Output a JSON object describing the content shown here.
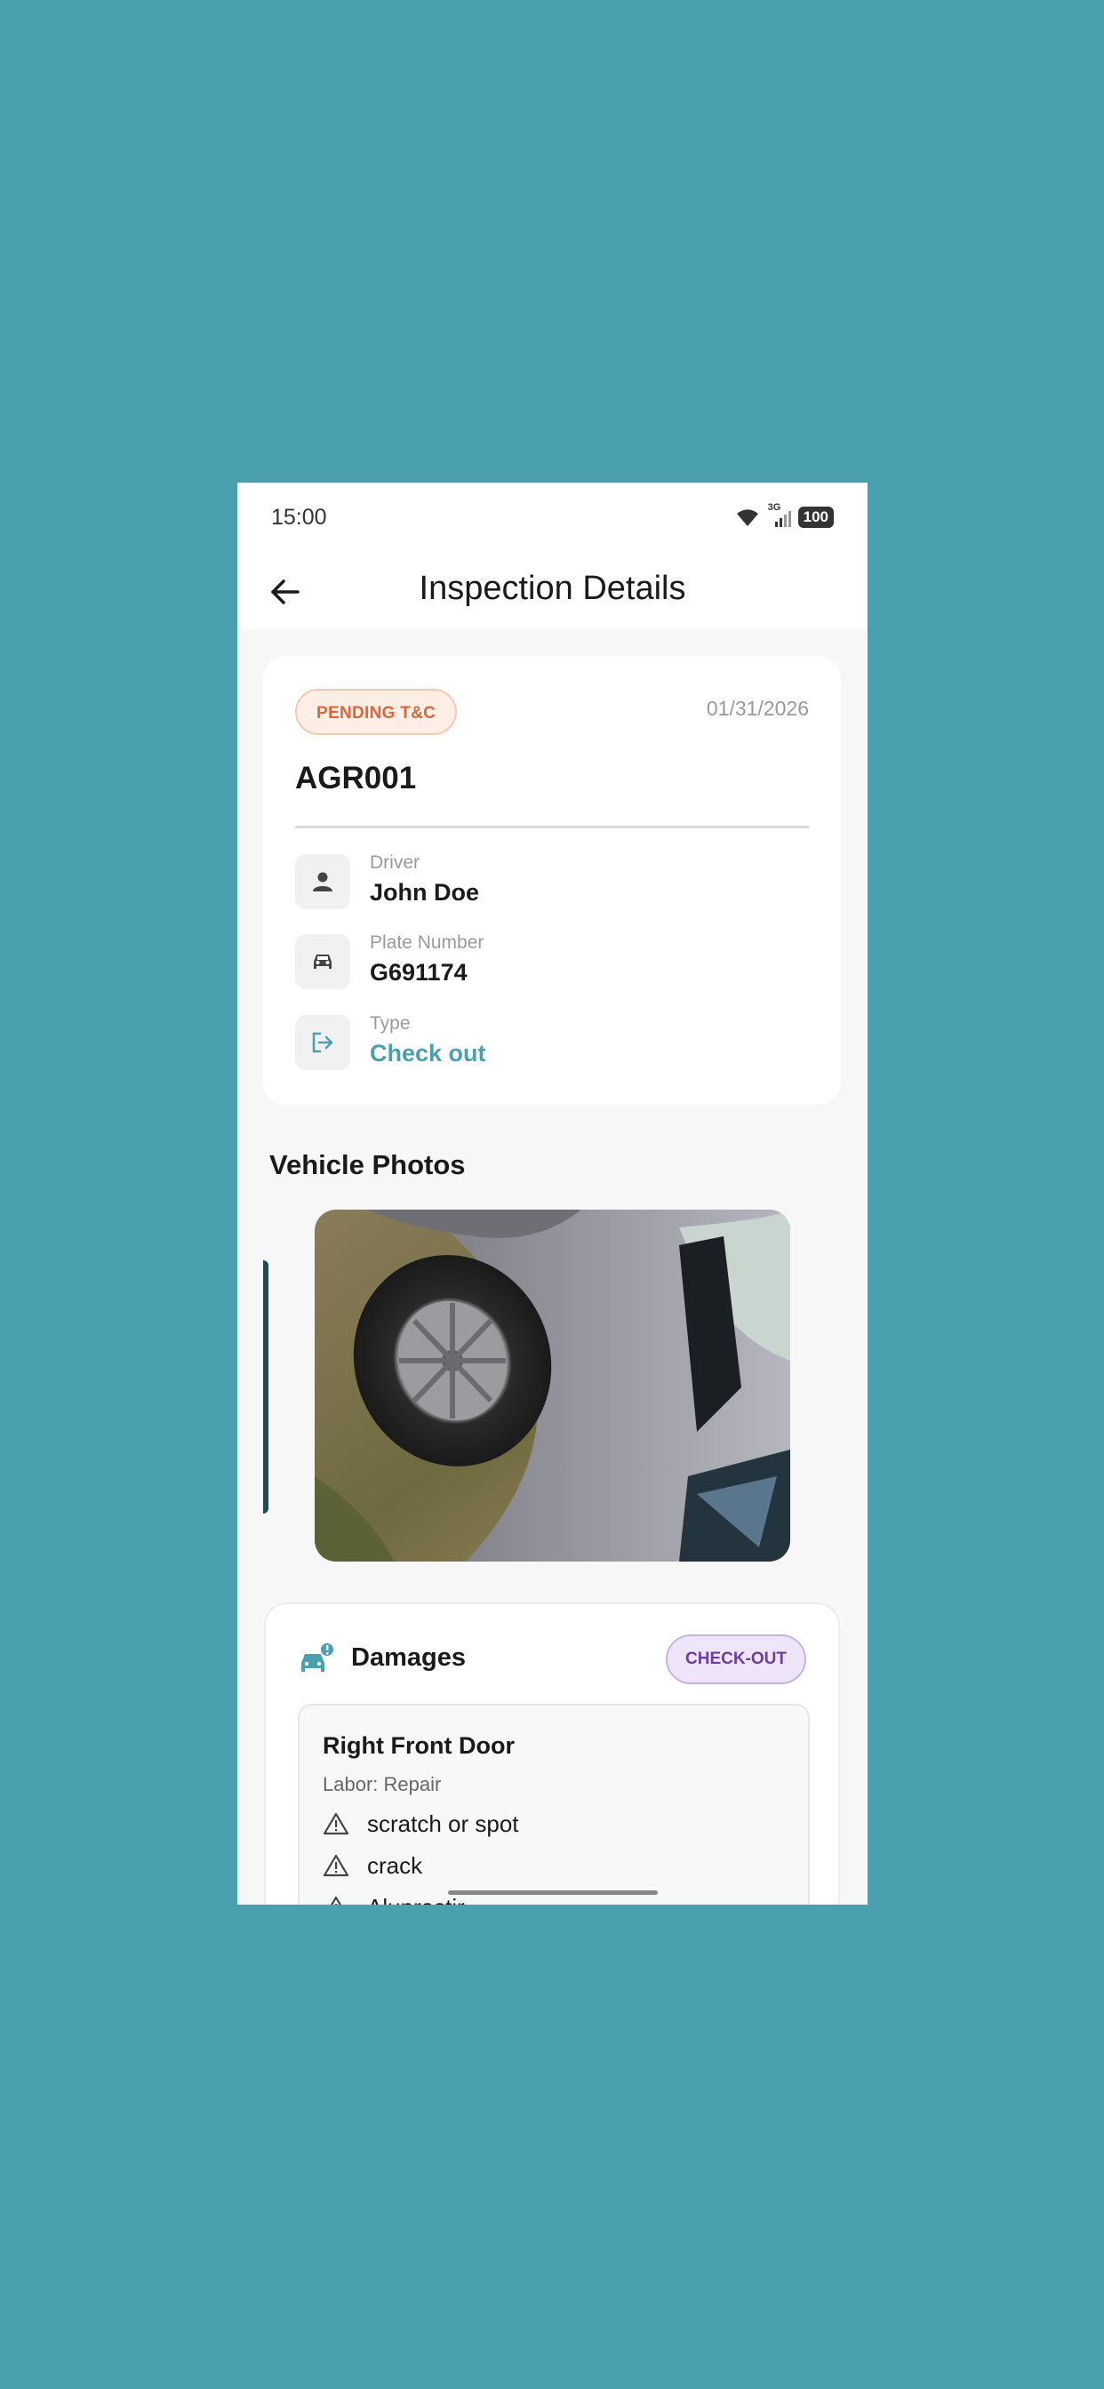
{
  "status_bar": {
    "time": "15:00",
    "network": "3G",
    "battery": "100",
    "icons": [
      "wifi-icon",
      "signal-icon",
      "battery-icon"
    ]
  },
  "app_bar": {
    "title": "Inspection Details",
    "back_icon": "arrow-left-icon"
  },
  "inspection": {
    "status": "PENDING T&C",
    "date": "01/31/2026",
    "id": "AGR001",
    "fields": [
      {
        "label": "Driver",
        "value": "John Doe",
        "icon": "person-icon"
      },
      {
        "label": "Plate Number",
        "value": "G691174",
        "icon": "car-icon"
      },
      {
        "label": "Type",
        "value": "Check out",
        "icon": "logout-icon"
      }
    ]
  },
  "photos": {
    "title": "Vehicle Photos"
  },
  "damages": {
    "title": "Damages",
    "badge": "CHECK-OUT",
    "items": [
      {
        "name": "Right Front Door",
        "labor": "Labor: Repair",
        "types": [
          "scratch or spot",
          "crack",
          "Aluprastir"
        ]
      }
    ]
  },
  "colors": {
    "background": "#4BA0AF",
    "accent": "#4BA0AF",
    "pending": "#E0663A",
    "checkout": "#6B3FA0"
  }
}
